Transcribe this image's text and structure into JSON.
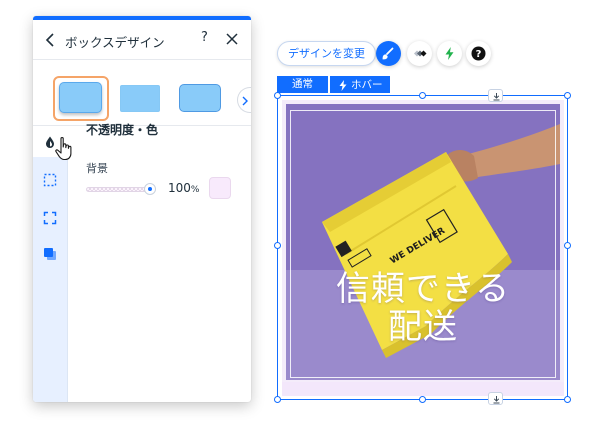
{
  "panel": {
    "title": "ボックスデザイン",
    "help_label": "?",
    "section_title": "不透明度・色",
    "background_label": "背景",
    "opacity_value": "100",
    "opacity_unit": "%",
    "opacity_level": 1.0,
    "background_color": "#f8eafc",
    "presets": [
      "preset-1",
      "preset-2",
      "preset-3"
    ],
    "selected_preset": 0,
    "side_nav": [
      "fill-opacity-icon",
      "border-icon",
      "corners-icon",
      "shadow-icon"
    ]
  },
  "toolbar": {
    "change_design_label": "デザインを変更",
    "buttons": [
      "design-brush-icon",
      "animation-icon",
      "interactions-bolt-icon",
      "help-icon"
    ]
  },
  "states": {
    "normal_label": "通常",
    "hover_label": "ホバー"
  },
  "box": {
    "headline": "信頼できる配送",
    "headline_line1": "信頼できる",
    "headline_line2": "配送",
    "package_text": "WE DELIVER"
  },
  "colors": {
    "accent": "#116dff",
    "preset_fill": "#89cbf9",
    "selected_preset_border": "#f5a468",
    "package": "#f4e04a",
    "image_bg": "#7b67b3"
  }
}
